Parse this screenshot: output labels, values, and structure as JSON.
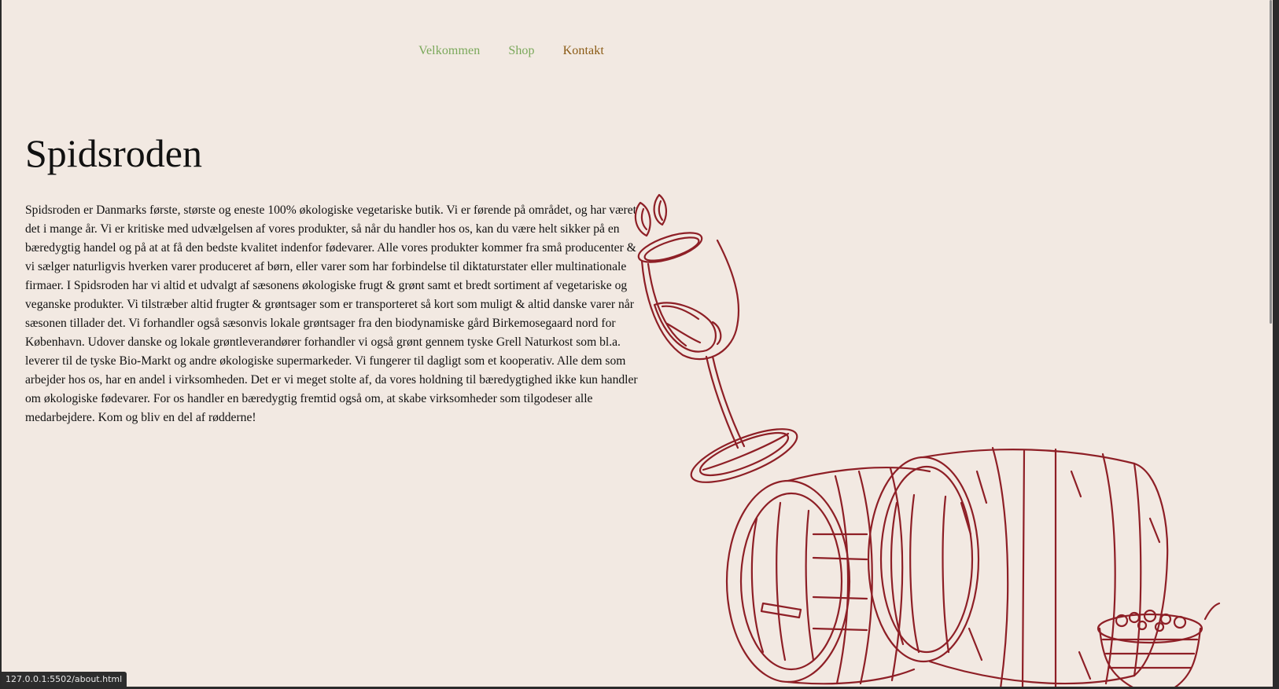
{
  "nav": {
    "items": [
      {
        "label": "Velkommen",
        "color": "#7aa85a"
      },
      {
        "label": "Shop",
        "color": "#7aa85a"
      },
      {
        "label": "Kontakt",
        "color": "#8a5a14"
      }
    ]
  },
  "page": {
    "title": "Spidsroden",
    "body": "Spidsroden er Danmarks første, største og eneste 100% økologiske vegetariske butik. Vi er førende på området, og har været det i mange år. Vi er kritiske med udvælgelsen af vores produkter, så når du handler hos os, kan du være helt sikker på en bæredygtig handel og på at at få den bedste kvalitet indenfor fødevarer. Alle vores produkter kommer fra små producenter & vi sælger naturligvis hverken varer produceret af børn, eller varer som har forbindelse til diktaturstater eller multinationale firmaer. I Spidsroden har vi altid et udvalgt af sæsonens økologiske frugt & grønt samt et bredt sortiment af vegetariske og veganske produkter. Vi tilstræber altid frugter & grøntsager som er transporteret så kort som muligt & altid danske varer når sæsonen tillader det. Vi forhandler også sæsonvis lokale grøntsager fra den biodynamiske gård Birkemosegaard nord for København. Udover danske og lokale grøntleverandører forhandler vi også grønt gennem tyske Grell Naturkost som bl.a. leverer til de tyske Bio-Markt og andre økologiske supermarkeder. Vi fungerer til dagligt som et kooperativ. Alle dem som arbejder hos os, har en andel i virksomheden. Det er vi meget stolte af, da vores holdning til bæredygtighed ikke kun handler om økologiske fødevarer. For os handler en bæredygtig fremtid også om, at skabe virksomheder som tilgodeser alle medarbejdere. Kom og bliv en del af rødderne!"
  },
  "illustration": {
    "name": "wine-glass-and-barrels-illustration",
    "stroke_color": "#8e1f26"
  },
  "status_bar": {
    "url": "127.0.0.1:5502/about.html"
  },
  "colors": {
    "background": "#f2e9e2",
    "text": "#111111"
  }
}
